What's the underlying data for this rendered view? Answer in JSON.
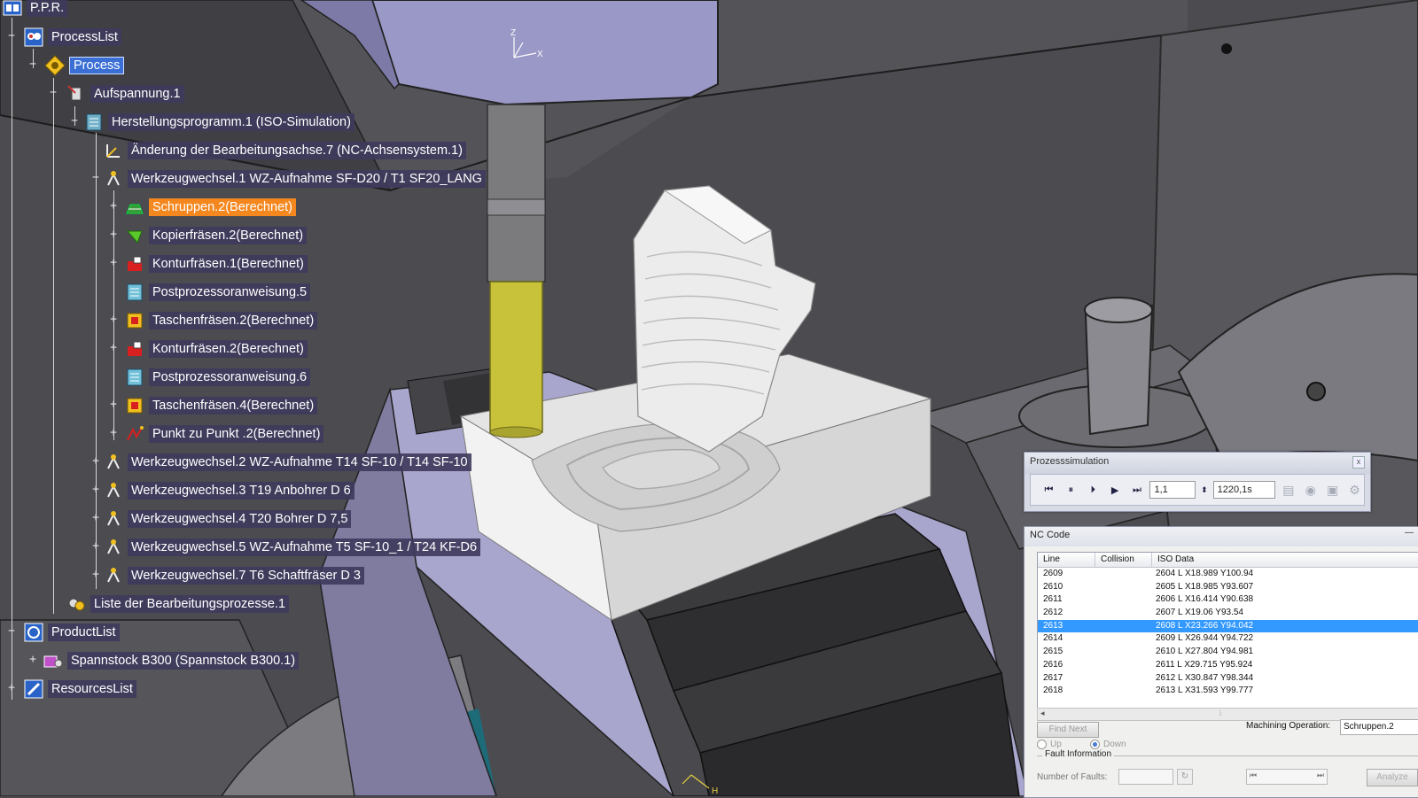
{
  "tree": {
    "nodes": [
      {
        "label": "P.P.R."
      },
      {
        "label": "ProcessList"
      },
      {
        "label": "Process"
      },
      {
        "label": "Aufspannung.1"
      },
      {
        "label": "Herstellungsprogramm.1 (ISO-Simulation)"
      },
      {
        "label": "Änderung der Bearbeitungsachse.7 (NC-Achsensystem.1)"
      },
      {
        "label": "Werkzeugwechsel.1  WZ-Aufnahme SF-D20 / T1 SF20_LANG"
      },
      {
        "label": "Schruppen.2(Berechnet)"
      },
      {
        "label": "Kopierfräsen.2(Berechnet)"
      },
      {
        "label": "Konturfräsen.1(Berechnet)"
      },
      {
        "label": "Postprozessoranweisung.5"
      },
      {
        "label": "Taschenfräsen.2(Berechnet)"
      },
      {
        "label": "Konturfräsen.2(Berechnet)"
      },
      {
        "label": "Postprozessoranweisung.6"
      },
      {
        "label": "Taschenfräsen.4(Berechnet)"
      },
      {
        "label": "Punkt zu Punkt .2(Berechnet)"
      },
      {
        "label": "Werkzeugwechsel.2  WZ-Aufnahme T14 SF-10 / T14 SF-10"
      },
      {
        "label": "Werkzeugwechsel.3  T19 Anbohrer D 6"
      },
      {
        "label": "Werkzeugwechsel.4  T20 Bohrer D 7,5"
      },
      {
        "label": "Werkzeugwechsel.5  WZ-Aufnahme T5 SF-10_1 / T24 KF-D6"
      },
      {
        "label": "Werkzeugwechsel.7  T6 Schaftfräser D 3"
      },
      {
        "label": "Liste der Bearbeitungsprozesse.1"
      },
      {
        "label": "ProductList"
      },
      {
        "label": "Spannstock B300 (Spannstock B300.1)"
      },
      {
        "label": "ResourcesList"
      }
    ]
  },
  "axis_labels": {
    "z": "Z",
    "x": "X",
    "h": "H"
  },
  "procsim": {
    "title": "Prozesssimulation",
    "close": "x",
    "step_value": "1,1",
    "time_value": "1220,1s"
  },
  "nccode": {
    "title": "NC Code",
    "minimize": "—",
    "columns": [
      "Line",
      "Collision",
      "ISO Data"
    ],
    "rows": [
      {
        "line": "2609",
        "collision": "",
        "iso": "2604 L X18.989 Y100.94"
      },
      {
        "line": "2610",
        "collision": "",
        "iso": "2605 L X18.985 Y93.607"
      },
      {
        "line": "2611",
        "collision": "",
        "iso": "2606 L X16.414 Y90.638"
      },
      {
        "line": "2612",
        "collision": "",
        "iso": "2607 L X19.06 Y93.54"
      },
      {
        "line": "2613",
        "collision": "",
        "iso": "2608 L X23.266 Y94.042"
      },
      {
        "line": "2614",
        "collision": "",
        "iso": "2609 L X26.944 Y94.722"
      },
      {
        "line": "2615",
        "collision": "",
        "iso": "2610 L X27.804 Y94.981"
      },
      {
        "line": "2616",
        "collision": "",
        "iso": "2611 L X29.715 Y95.924"
      },
      {
        "line": "2617",
        "collision": "",
        "iso": "2612 L X30.847 Y98.344"
      },
      {
        "line": "2618",
        "collision": "",
        "iso": "2613 L X31.593 Y99.777"
      }
    ],
    "selected_row": 4,
    "find_next": "Find Next",
    "machining_operation_label": "Machining Operation:",
    "machining_operation_value": "Schruppen.2",
    "up_label": "Up",
    "down_label": "Down",
    "fault_title": "Fault Information",
    "faults_label": "Number of Faults:",
    "analyze": "Analyze"
  },
  "colors": {
    "tree_label_bg": "#3e3a5c",
    "selected": "#3b6fd6",
    "active_operation": "#f5871f",
    "tool_highlight": "#c8c23a",
    "nc_selected_row": "#3399ff"
  }
}
